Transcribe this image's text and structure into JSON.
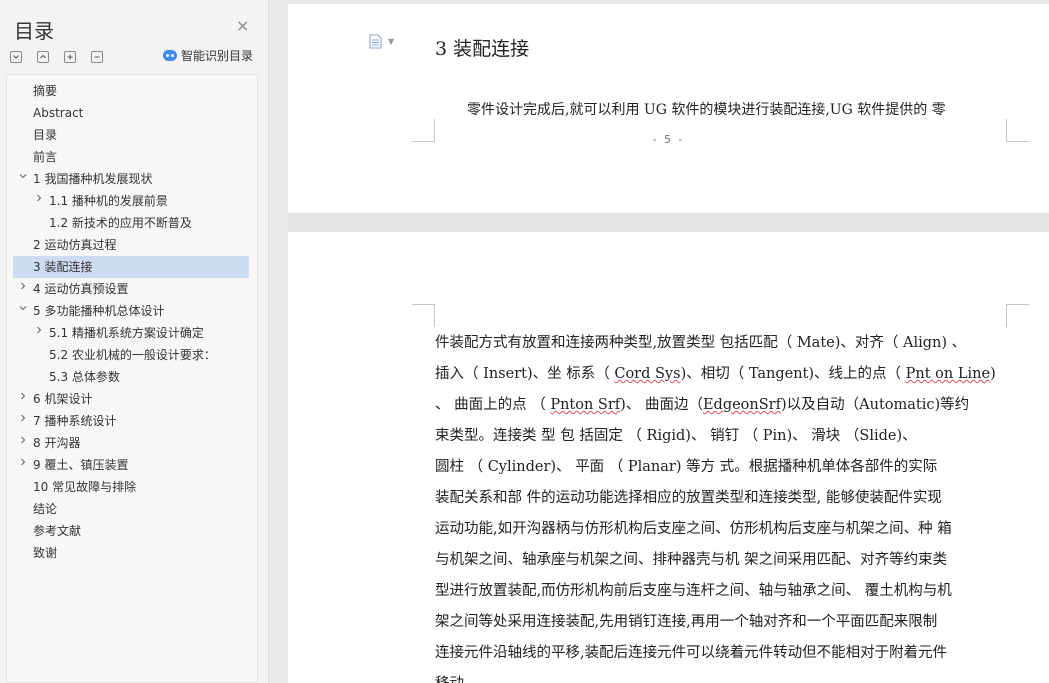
{
  "sidebar": {
    "title": "目录",
    "close_icon": "×",
    "smart_label": "智能识别目录",
    "tools": [
      {
        "name": "expand-all",
        "glyph": "⌄"
      },
      {
        "name": "collapse-all",
        "glyph": "⌃"
      },
      {
        "name": "add-heading",
        "glyph": "+"
      },
      {
        "name": "remove-heading",
        "glyph": "−"
      }
    ],
    "toc": [
      {
        "label": "摘要",
        "indent": 1,
        "chevron": ""
      },
      {
        "label": "Abstract",
        "indent": 1,
        "chevron": ""
      },
      {
        "label": "目录",
        "indent": 1,
        "chevron": ""
      },
      {
        "label": "前言",
        "indent": 1,
        "chevron": ""
      },
      {
        "label": "1 我国播种机发展现状",
        "indent": 1,
        "chevron": "down"
      },
      {
        "label": "1.1 播种机的发展前景",
        "indent": 2,
        "chevron": "right"
      },
      {
        "label": "1.2 新技术的应用不断普及",
        "indent": 2,
        "chevron": ""
      },
      {
        "label": "2 运动仿真过程",
        "indent": 1,
        "chevron": ""
      },
      {
        "label": "3 装配连接",
        "indent": 1,
        "chevron": "",
        "active": true
      },
      {
        "label": "4  运动仿真预设置",
        "indent": 1,
        "chevron": "right"
      },
      {
        "label": "5 多功能播种机总体设计",
        "indent": 1,
        "chevron": "down"
      },
      {
        "label": "5.1 精播机系统方案设计确定",
        "indent": 2,
        "chevron": "right"
      },
      {
        "label": "5.2 农业机械的一般设计要求：",
        "indent": 2,
        "chevron": ""
      },
      {
        "label": "5.3 总体参数",
        "indent": 2,
        "chevron": ""
      },
      {
        "label": "6 机架设计",
        "indent": 1,
        "chevron": "right"
      },
      {
        "label": "7 播种系统设计",
        "indent": 1,
        "chevron": "right"
      },
      {
        "label": "8 开沟器",
        "indent": 1,
        "chevron": "right"
      },
      {
        "label": "9 覆土、镇压装置",
        "indent": 1,
        "chevron": "right"
      },
      {
        "label": "10  常见故障与排除",
        "indent": 1,
        "chevron": ""
      },
      {
        "label": "结论",
        "indent": 1,
        "chevron": ""
      },
      {
        "label": "参考文献",
        "indent": 1,
        "chevron": ""
      },
      {
        "label": "致谢",
        "indent": 1,
        "chevron": ""
      }
    ]
  },
  "document": {
    "heading": "3 装配连接",
    "para1": "零件设计完成后,就可以利用 UG 软件的模块进行装配连接,UG 软件提供的 零",
    "page_number": "- 5 -",
    "body_lines": [
      "件装配方式有放置和连接两种类型,放置类型 包括匹配（ Mate)、对齐（ Align) 、",
      "插入（ Insert)、坐 标系（ Cord Sys)、相切（ Tangent)、线上的点（ Pnt on Line)",
      "、 曲面上的点 （ Pnton Srf)、 曲面边（EdgeonSrf)以及自动（Automatic)等约",
      "束类型。连接类 型 包 括固定 （ Rigid)、 销钉 （ Pin)、 滑块 （Slide)、",
      "圆柱 （ Cylinder)、 平面 （ Planar) 等方 式。根据播种机单体各部件的实际",
      "装配关系和部 件的运动功能选择相应的放置类型和连接类型, 能够使装配件实现",
      "运动功能,如开沟器柄与仿形机构后支座之间、仿形机构后支座与机架之间、种 箱",
      "与机架之间、轴承座与机架之间、排种器壳与机 架之间采用匹配、对齐等约束类",
      "型进行放置装配,而仿形机构前后支座与连杆之间、轴与轴承之间、 覆土机构与机",
      "架之间等处采用连接装配,先用销钉连接,再用一个轴对齐和一个平面匹配来限制",
      "连接元件沿轴线的平移,装配后连接元件可以绕着元件转动但不能相对于附着元件",
      "移动。"
    ]
  },
  "colors": {
    "active_item": "#cddcf1",
    "accent": "#3b8bf0"
  }
}
